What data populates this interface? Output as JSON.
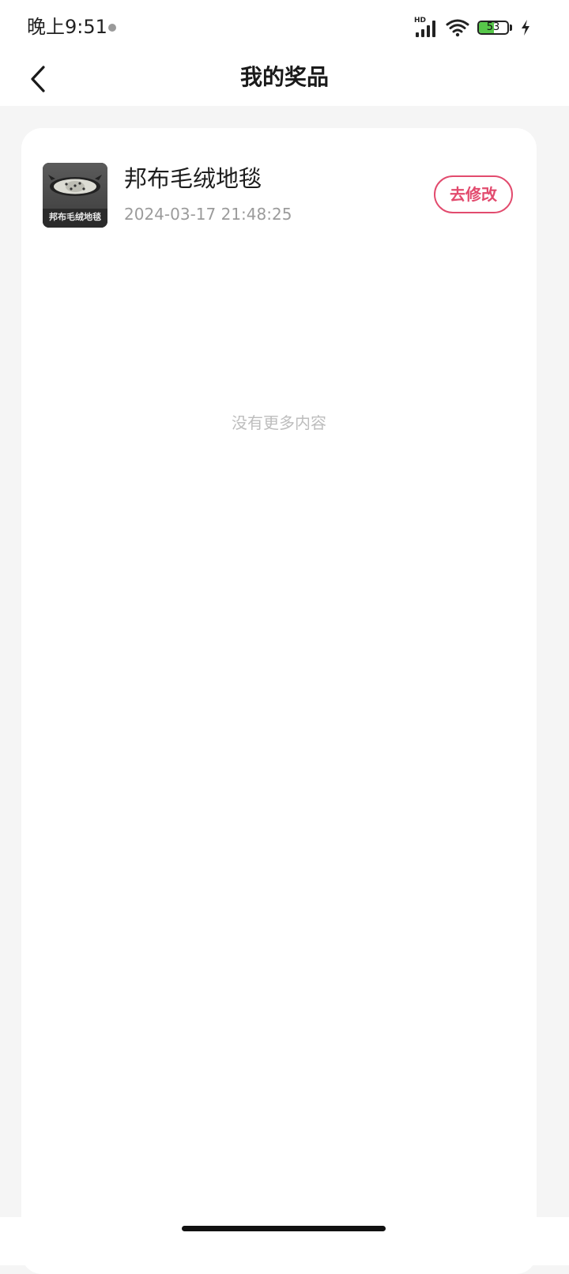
{
  "status_bar": {
    "time": "晚上9:51",
    "network_badge": "HD",
    "battery_level": "53",
    "battery_fraction": 0.53,
    "icons": [
      "signal-icon",
      "wifi-icon",
      "battery-icon",
      "charging-icon"
    ],
    "battery_color": "#57c74a"
  },
  "header": {
    "title": "我的奖品",
    "back_icon": "back-arrow-icon"
  },
  "prizes": [
    {
      "name": "邦布毛绒地毯",
      "time": "2024-03-17 21:48:25",
      "thumb_text": "邦布毛绒地毯",
      "action_label": "去修改"
    }
  ],
  "list_footer": "没有更多内容",
  "colors": {
    "accent": "#e24b6e",
    "page_bg": "#f5f5f5",
    "card_bg": "#ffffff",
    "muted_text": "#9b9b9b"
  }
}
